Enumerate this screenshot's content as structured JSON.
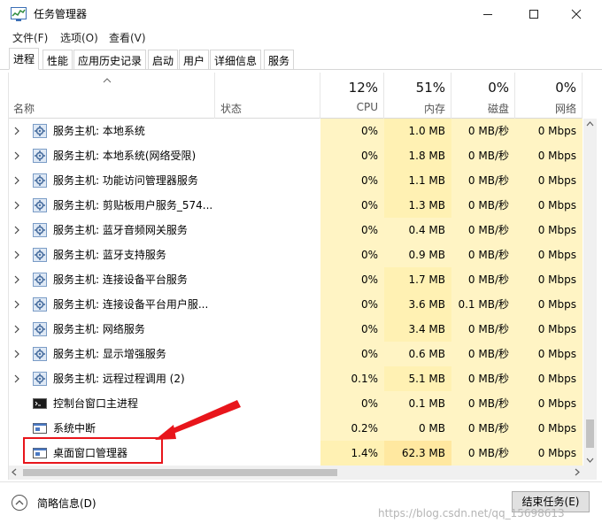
{
  "window": {
    "title": "任务管理器",
    "min_symbol": "—",
    "max_symbol": "☐",
    "close_symbol": "✕"
  },
  "menu": [
    "文件(F)",
    "选项(O)",
    "查看(V)"
  ],
  "tabs": [
    "进程",
    "性能",
    "应用历史记录",
    "启动",
    "用户",
    "详细信息",
    "服务"
  ],
  "active_tab": "进程",
  "header": {
    "name": "名称",
    "status": "状态",
    "cpu": {
      "pct": "12%",
      "label": "CPU"
    },
    "mem": {
      "pct": "51%",
      "label": "内存"
    },
    "disk": {
      "pct": "0%",
      "label": "磁盘"
    },
    "net": {
      "pct": "0%",
      "label": "网络"
    }
  },
  "rows": [
    {
      "name": "服务主机: 本地系统",
      "expandable": true,
      "icon": "gear-icon",
      "cpu": "0%",
      "mem": "1.0 MB",
      "disk": "0 MB/秒",
      "net": "0 Mbps"
    },
    {
      "name": "服务主机: 本地系统(网络受限)",
      "expandable": true,
      "icon": "gear-icon",
      "cpu": "0%",
      "mem": "1.8 MB",
      "disk": "0 MB/秒",
      "net": "0 Mbps"
    },
    {
      "name": "服务主机: 功能访问管理器服务",
      "expandable": true,
      "icon": "gear-icon",
      "cpu": "0%",
      "mem": "1.1 MB",
      "disk": "0 MB/秒",
      "net": "0 Mbps"
    },
    {
      "name": "服务主机: 剪贴板用户服务_574...",
      "expandable": true,
      "icon": "gear-icon",
      "cpu": "0%",
      "mem": "1.3 MB",
      "disk": "0 MB/秒",
      "net": "0 Mbps"
    },
    {
      "name": "服务主机: 蓝牙音频网关服务",
      "expandable": true,
      "icon": "gear-icon",
      "cpu": "0%",
      "mem": "0.4 MB",
      "disk": "0 MB/秒",
      "net": "0 Mbps"
    },
    {
      "name": "服务主机: 蓝牙支持服务",
      "expandable": true,
      "icon": "gear-icon",
      "cpu": "0%",
      "mem": "0.9 MB",
      "disk": "0 MB/秒",
      "net": "0 Mbps"
    },
    {
      "name": "服务主机: 连接设备平台服务",
      "expandable": true,
      "icon": "gear-icon",
      "cpu": "0%",
      "mem": "1.7 MB",
      "disk": "0 MB/秒",
      "net": "0 Mbps"
    },
    {
      "name": "服务主机: 连接设备平台用户服...",
      "expandable": true,
      "icon": "gear-icon",
      "cpu": "0%",
      "mem": "3.6 MB",
      "disk": "0.1 MB/秒",
      "net": "0 Mbps"
    },
    {
      "name": "服务主机: 网络服务",
      "expandable": true,
      "icon": "gear-icon",
      "cpu": "0%",
      "mem": "3.4 MB",
      "disk": "0 MB/秒",
      "net": "0 Mbps"
    },
    {
      "name": "服务主机: 显示增强服务",
      "expandable": true,
      "icon": "gear-icon",
      "cpu": "0%",
      "mem": "0.6 MB",
      "disk": "0 MB/秒",
      "net": "0 Mbps"
    },
    {
      "name": "服务主机: 远程过程调用 (2)",
      "expandable": true,
      "icon": "gear-icon",
      "cpu": "0.1%",
      "mem": "5.1 MB",
      "disk": "0 MB/秒",
      "net": "0 Mbps"
    },
    {
      "name": "控制台窗口主进程",
      "expandable": false,
      "icon": "console-icon",
      "cpu": "0%",
      "mem": "0.1 MB",
      "disk": "0 MB/秒",
      "net": "0 Mbps"
    },
    {
      "name": "系统中断",
      "expandable": false,
      "icon": "window-icon",
      "cpu": "0.2%",
      "mem": "0 MB",
      "disk": "0 MB/秒",
      "net": "0 Mbps"
    },
    {
      "name": "桌面窗口管理器",
      "expandable": false,
      "icon": "window-icon",
      "cpu": "1.4%",
      "mem": "62.3 MB",
      "disk": "0 MB/秒",
      "net": "0 Mbps"
    }
  ],
  "footer": {
    "fewer_details": "简略信息(D)",
    "end_task": "结束任务(E)",
    "watermark": "https://blog.csdn.net/qq_15698613"
  },
  "colors": {
    "heat_low": "#fff4c4",
    "heat_mid": "#fff1b3",
    "heat_high": "#ffe8a0",
    "annotation_red": "#e8151b"
  }
}
